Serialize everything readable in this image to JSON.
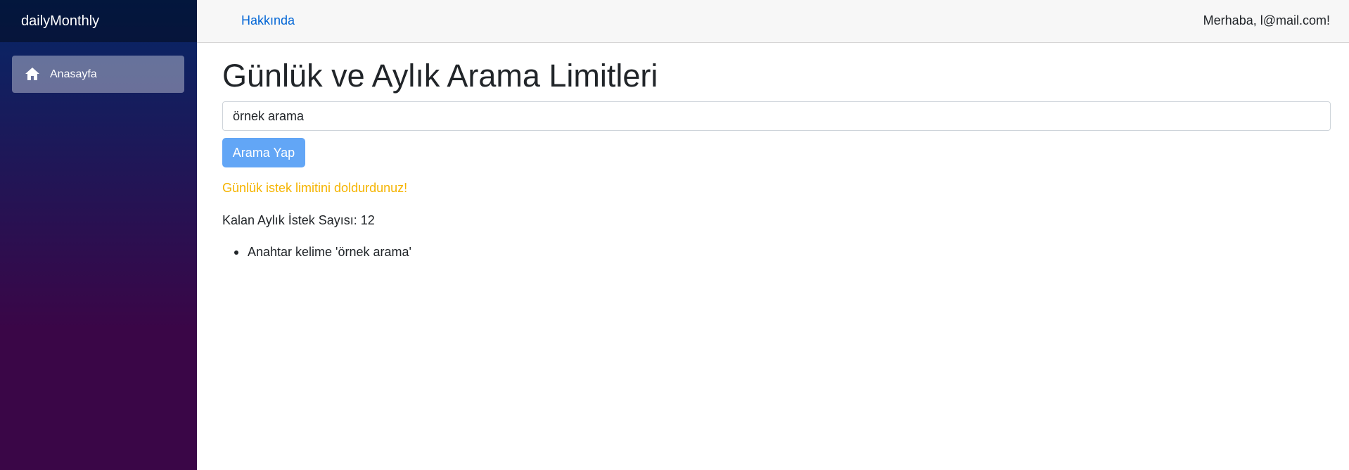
{
  "sidebar": {
    "brand": "dailyMonthly",
    "items": [
      {
        "label": "Anasayfa",
        "icon": "home-icon",
        "active": true
      }
    ]
  },
  "topbar": {
    "about_link": "Hakkında",
    "greeting": "Merhaba, l@mail.com!"
  },
  "main": {
    "title": "Günlük ve Aylık Arama Limitleri",
    "search_value": "örnek arama",
    "search_button": "Arama Yap",
    "warning": "Günlük istek limitini doldurdunuz!",
    "remaining_label": "Kalan Aylık İstek Sayısı:",
    "remaining_count": "12",
    "keywords": [
      "Anahtar kelime 'örnek arama'"
    ]
  },
  "colors": {
    "sidebar_top": "#052767",
    "sidebar_bottom": "#3a0647",
    "link": "#0366d6",
    "button": "#62a6f6",
    "warning": "#f5b400"
  }
}
